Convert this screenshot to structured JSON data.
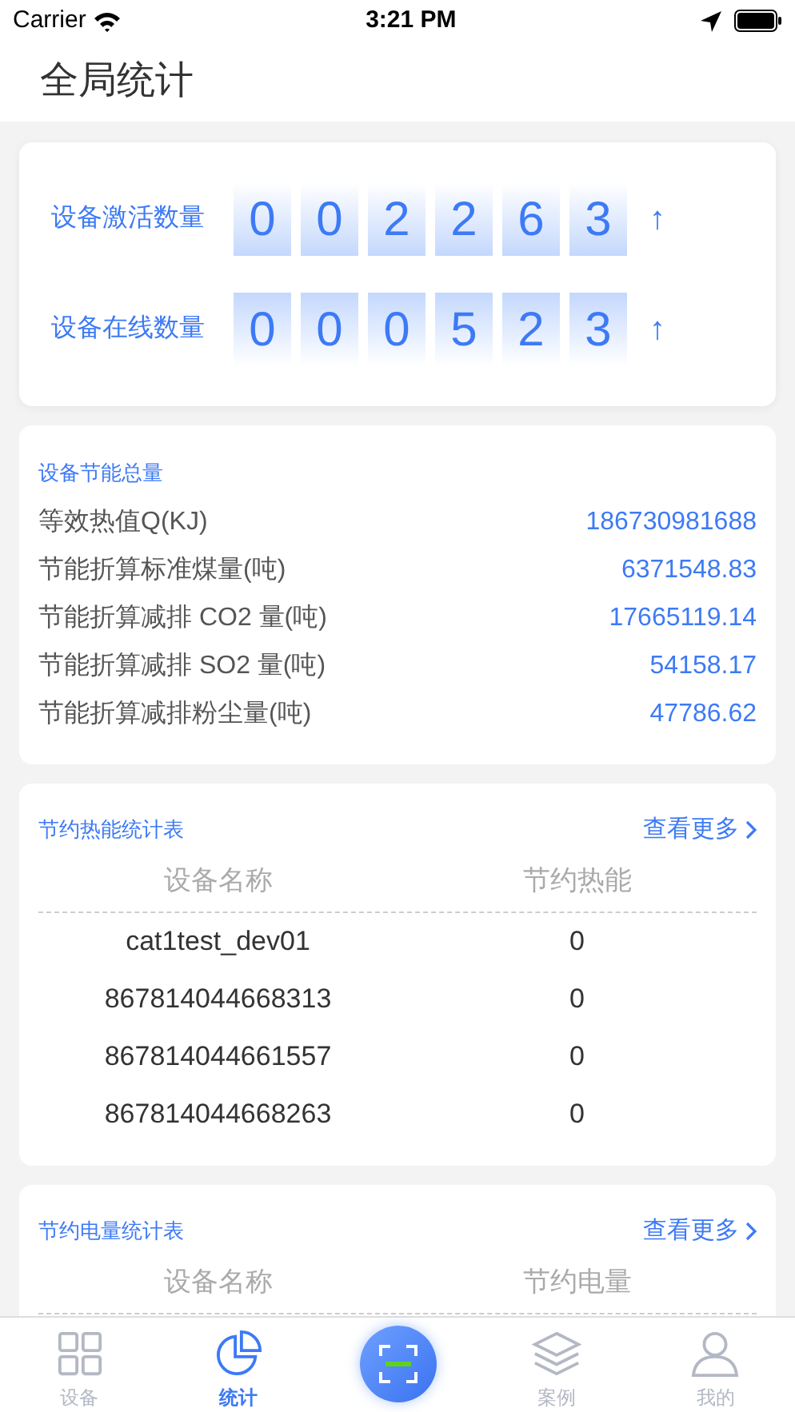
{
  "status_bar": {
    "carrier": "Carrier",
    "time": "3:21 PM"
  },
  "title": "全局统计",
  "counters": [
    {
      "label": "设备激活数量",
      "digits": [
        "0",
        "0",
        "2",
        "2",
        "6",
        "3"
      ],
      "arrow": "↑"
    },
    {
      "label": "设备在线数量",
      "digits": [
        "0",
        "0",
        "0",
        "5",
        "2",
        "3"
      ],
      "arrow": "↑"
    }
  ],
  "savings": {
    "title": "设备节能总量",
    "rows": [
      {
        "label": "等效热值Q(KJ)",
        "value": "186730981688"
      },
      {
        "label": "节能折算标准煤量(吨)",
        "value": "6371548.83"
      },
      {
        "label": "节能折算减排 CO2 量(吨)",
        "value": "17665119.14"
      },
      {
        "label": "节能折算减排 SO2 量(吨)",
        "value": "54158.17"
      },
      {
        "label": "节能折算减排粉尘量(吨)",
        "value": "47786.62"
      }
    ]
  },
  "tables": [
    {
      "title": "节约热能统计表",
      "more": "查看更多",
      "columns": [
        "设备名称",
        "节约热能"
      ],
      "rows": [
        [
          "cat1test_dev01",
          "0"
        ],
        [
          "867814044668313",
          "0"
        ],
        [
          "867814044661557",
          "0"
        ],
        [
          "867814044668263",
          "0"
        ]
      ]
    },
    {
      "title": "节约电量统计表",
      "more": "查看更多",
      "columns": [
        "设备名称",
        "节约电量"
      ]
    }
  ],
  "tab_bar": [
    {
      "kind": "grid",
      "label": "设备",
      "selected": false
    },
    {
      "kind": "chart",
      "label": "统计",
      "selected": true
    },
    {
      "kind": "scan",
      "selected": false
    },
    {
      "kind": "layers",
      "label": "案例",
      "selected": false
    },
    {
      "kind": "user",
      "label": "我的",
      "selected": false
    }
  ]
}
